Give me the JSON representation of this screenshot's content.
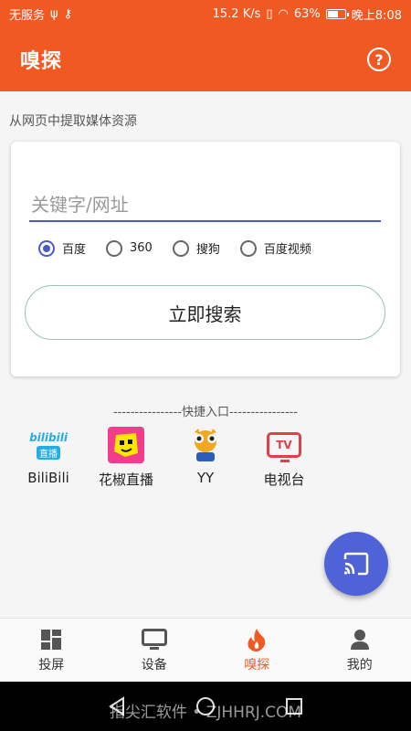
{
  "status_bar": {
    "carrier": "无服务",
    "speed": "15.2 K/s",
    "battery": "63%",
    "battery_level": 0.63,
    "time": "晚上8:08"
  },
  "app_bar": {
    "title": "嗅探",
    "help_icon": "help-circle-icon"
  },
  "subtitle": "从网页中提取媒体资源",
  "search": {
    "placeholder": "关键字/网址",
    "value": "",
    "engines": [
      {
        "label": "百度",
        "checked": true
      },
      {
        "label": "360",
        "checked": false
      },
      {
        "label": "搜狗",
        "checked": false
      },
      {
        "label": "百度视频",
        "checked": false
      }
    ],
    "button_label": "立即搜索"
  },
  "quick": {
    "title": "----------------快捷入口----------------",
    "items": [
      {
        "label": "BiliBili",
        "icon": "bilibili-icon",
        "icon_text": "bilibili",
        "icon_sub": "直播"
      },
      {
        "label": "花椒直播",
        "icon": "huajiao-icon"
      },
      {
        "label": "YY",
        "icon": "yy-icon"
      },
      {
        "label": "电视台",
        "icon": "tv-icon",
        "icon_text": "TV"
      }
    ]
  },
  "fab": {
    "icon": "cast-icon"
  },
  "bottom_nav": [
    {
      "label": "投屏",
      "icon": "grid-icon",
      "active": false
    },
    {
      "label": "设备",
      "icon": "monitor-icon",
      "active": false
    },
    {
      "label": "嗅探",
      "icon": "flame-icon",
      "active": true
    },
    {
      "label": "我的",
      "icon": "person-icon",
      "active": false
    }
  ],
  "watermark": "指尖汇软件 • ZJHHRJ.COM",
  "colors": {
    "primary": "#f05a22",
    "accent": "#4f62d8",
    "input_line": "#4a5bc4"
  }
}
